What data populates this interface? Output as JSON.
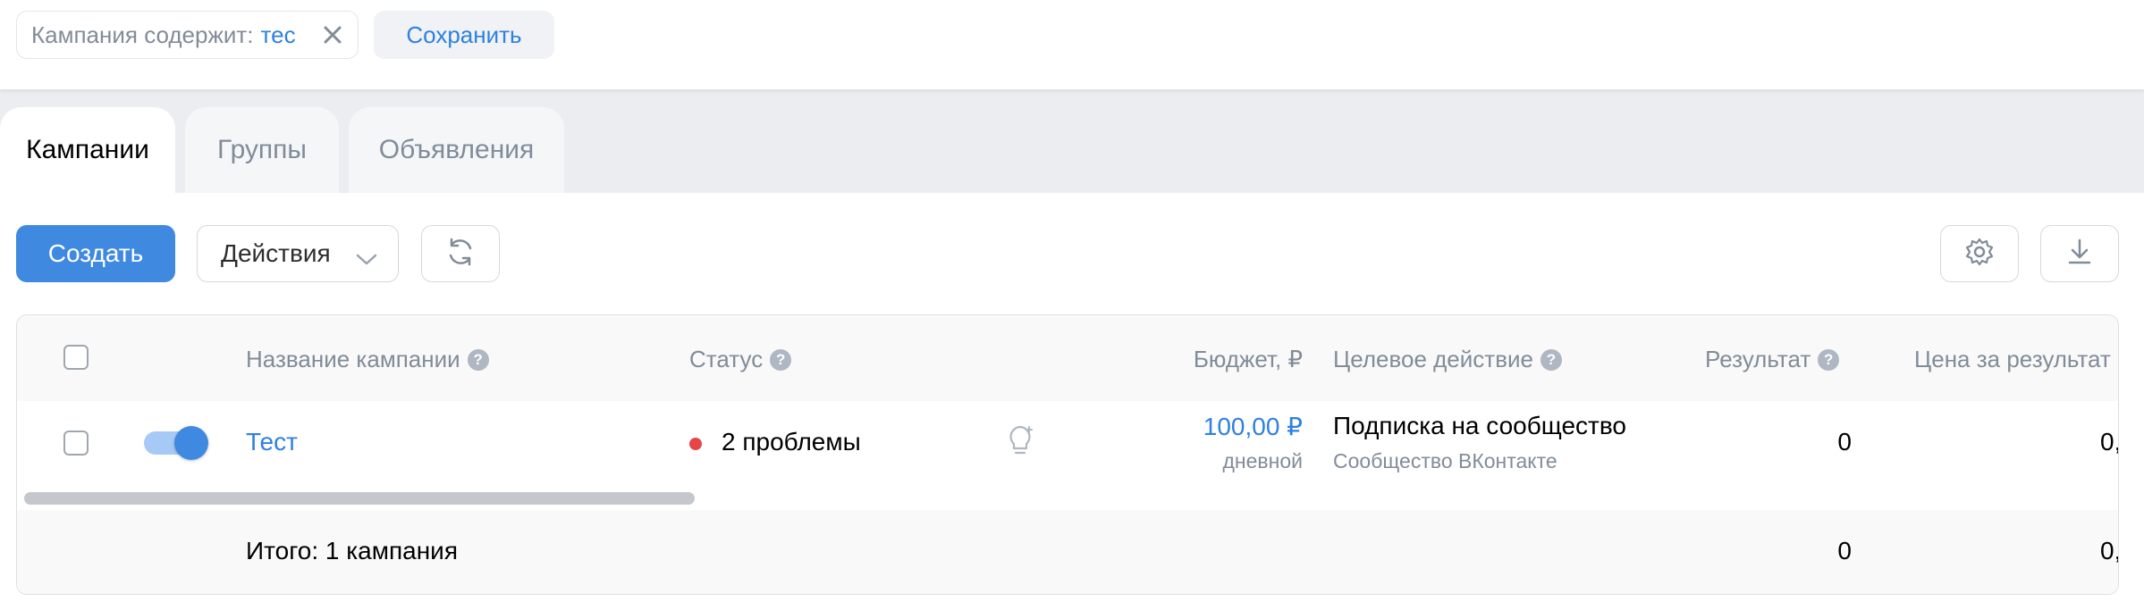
{
  "filter": {
    "label": "Кампания содержит:",
    "value": "тес",
    "clear_icon": "close-icon",
    "save_label": "Сохранить"
  },
  "tabs": [
    {
      "label": "Кампании",
      "active": true
    },
    {
      "label": "Группы",
      "active": false
    },
    {
      "label": "Объявления",
      "active": false
    }
  ],
  "toolbar": {
    "create_label": "Создать",
    "actions_label": "Действия",
    "refresh_icon": "refresh-icon",
    "settings_icon": "gear-icon",
    "download_icon": "download-icon"
  },
  "table": {
    "columns": {
      "name": "Название кампании",
      "status": "Статус",
      "budget": "Бюджет, ₽",
      "target": "Целевое действие",
      "result": "Результат",
      "price": "Цена за результат"
    },
    "rows": [
      {
        "name": "Тест",
        "enabled": true,
        "status": "2 проблемы",
        "budget": "100,00 ₽",
        "budget_period": "дневной",
        "target": "Подписка на сообщество",
        "target_sub": "Сообщество ВКонтакте",
        "result": "0",
        "price": "0,"
      }
    ],
    "footer": {
      "total": "Итого: 1 кампания",
      "result": "0",
      "price": "0,"
    }
  },
  "colors": {
    "accent": "#2d81e0",
    "primary_button": "#3f8ae0",
    "status_dot": "#e64646"
  }
}
